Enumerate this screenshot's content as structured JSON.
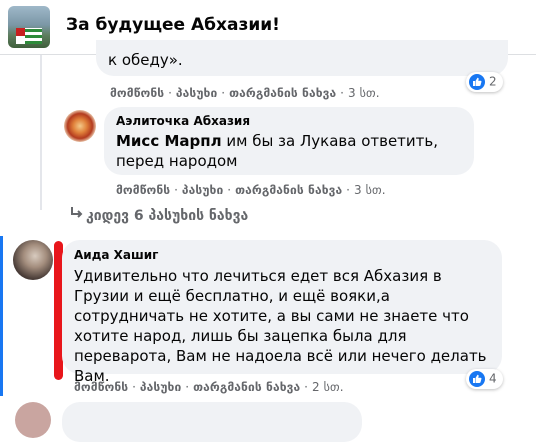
{
  "header": {
    "title": "За будущее Абхазии!"
  },
  "reply1": {
    "text_tail": "к обеду».",
    "actions": {
      "like": "მომწონს",
      "reply": "პასუხი",
      "translate": "თარგმანის ნახვა",
      "time": "3 სთ."
    },
    "reactions": "2"
  },
  "reply2": {
    "author": "Аэлиточка Абхазия",
    "mention": "Мисс Марпл",
    "text": " им бы за Лукава ответить, перед народом",
    "actions": {
      "like": "მომწონს",
      "reply": "პასუხი",
      "translate": "თარგმანის ნახვა",
      "time": "3 სთ."
    }
  },
  "view_more": "კიდევ 6 პასუხის ნახვა",
  "comment": {
    "author": "Аида Хашиг",
    "text": "Удивительно что лечиться едет вся Абхазия в Грузии и ещё бесплатно, и ещё вояки,а сотрудничать не хотите, а вы сами не знаете что хотите народ, лишь бы зацепка была для переварота, Вам не надоела всё или нечего делать Вам.",
    "actions": {
      "like": "მომწონს",
      "reply": "პასუხი",
      "translate": "თარგმანის ნახვა",
      "time": "2 სთ."
    },
    "reactions": "4"
  },
  "colors": {
    "accent": "#1877f2",
    "bubble": "#f0f2f5",
    "marker": "#e8161b"
  },
  "icons": [
    "like-icon",
    "reply-arrow-icon"
  ]
}
